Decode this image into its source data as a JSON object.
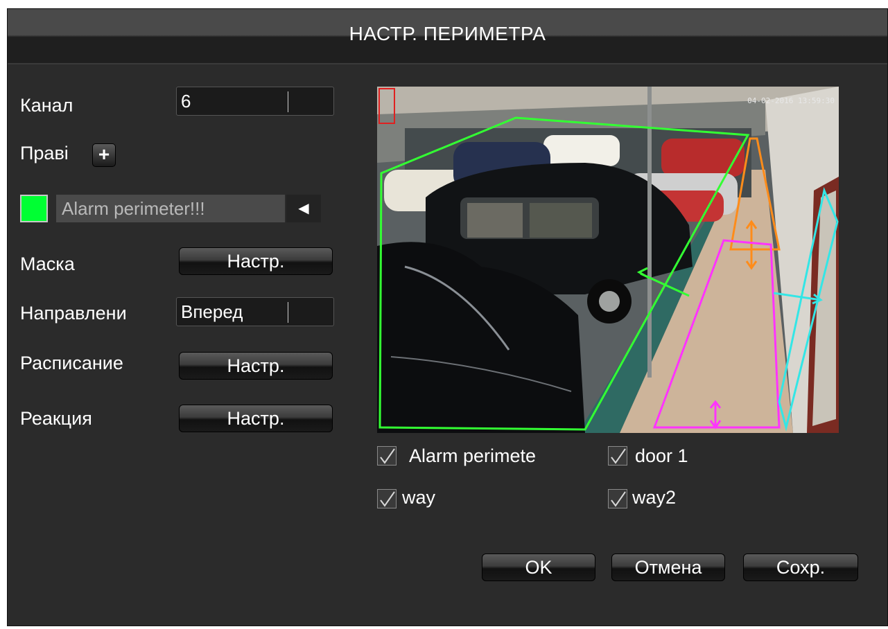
{
  "window": {
    "title": "НАСТР. ПЕРИМЕТРА"
  },
  "form": {
    "channel_label": "Канал",
    "channel_value": "6",
    "rule_label": "Правi",
    "rule_name": "Alarm perimeter!!!",
    "rule_color": "#00ff33",
    "mask_label": "Маска",
    "mask_button": "Настр.",
    "direction_label": "Направлени",
    "direction_value": "Вперед",
    "schedule_label": "Расписание",
    "schedule_button": "Настр.",
    "reaction_label": "Реакция",
    "reaction_button": "Настр."
  },
  "preview": {
    "timestamp": "04-02-2016 13:59:30",
    "zone_colors": {
      "alarm_perimeter": "#33ff33",
      "door_1": "#ff8c1a",
      "way": "#ff33ff",
      "way2": "#33e6e6"
    }
  },
  "rules_list": [
    {
      "label": "Alarm perimete",
      "checked": true
    },
    {
      "label": "door 1",
      "checked": true
    },
    {
      "label": "way",
      "checked": true
    },
    {
      "label": "way2",
      "checked": true
    }
  ],
  "buttons": {
    "ok": "OK",
    "cancel": "Отмена",
    "save": "Сохр."
  }
}
